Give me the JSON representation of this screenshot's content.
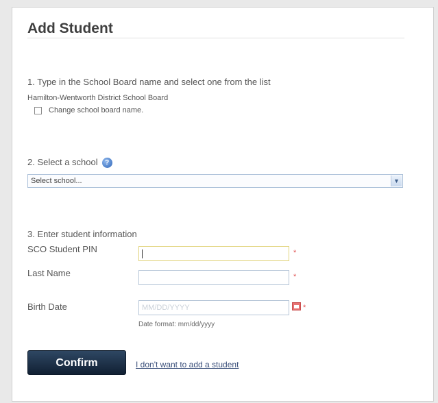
{
  "page": {
    "title": "Add Student"
  },
  "step1": {
    "heading": "1. Type in the School Board name and select one from the list",
    "board_name": "Hamilton-Wentworth District School Board",
    "change_label": "Change school board name."
  },
  "step2": {
    "heading": "2. Select a school",
    "select_value": "Select school..."
  },
  "step3": {
    "heading": "3. Enter student information",
    "pin_label": "SCO Student PIN",
    "last_name_label": "Last Name",
    "birth_date_label": "Birth Date",
    "birth_date_placeholder": "MM/DD/YYYY",
    "date_format_hint": "Date format: mm/dd/yyyy",
    "required_marker": "*"
  },
  "actions": {
    "confirm_label": "Confirm",
    "cancel_link": "I don't want to add a student"
  },
  "icons": {
    "help": "help-icon",
    "dropdown": "chevron-down-icon",
    "calendar": "calendar-icon"
  },
  "colors": {
    "button": "#1b2d44",
    "required": "#e05050",
    "link": "#3a4f7a"
  }
}
